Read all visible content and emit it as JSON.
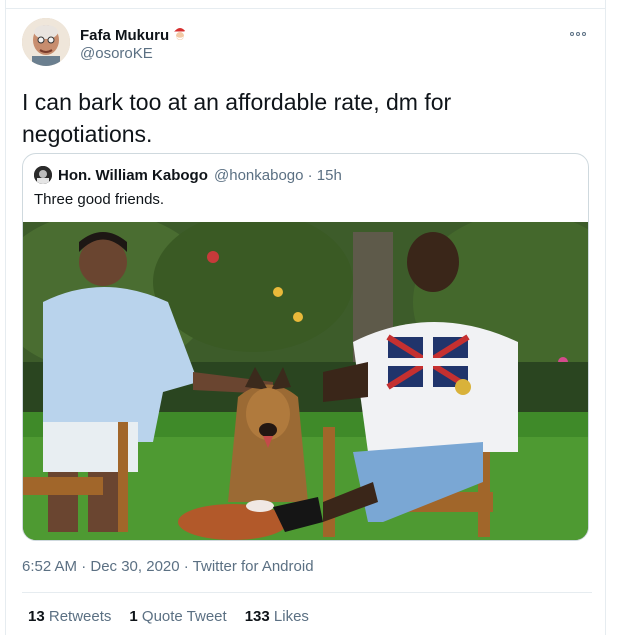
{
  "author": {
    "name": "Fafa Mukuru",
    "handle": "@osoroKE",
    "emoji_badge": "santa-emoji"
  },
  "tweet": {
    "text": "I can bark too at an affordable rate, dm for negotiations."
  },
  "quoted": {
    "name": "Hon. William Kabogo",
    "meta": "@honkabogo · 15h",
    "text": "Three good friends."
  },
  "footer": {
    "timestamp": "6:52 AM · Dec 30, 2020 · Twitter for Android",
    "retweets_count": "13",
    "retweets_label": "Retweets",
    "quotes_count": "1",
    "quotes_label": "Quote Tweet",
    "likes_count": "133",
    "likes_label": "Likes"
  },
  "colors": {
    "text_primary": "#0f1419",
    "text_secondary": "#5b7083",
    "border": "#cfd9de"
  }
}
